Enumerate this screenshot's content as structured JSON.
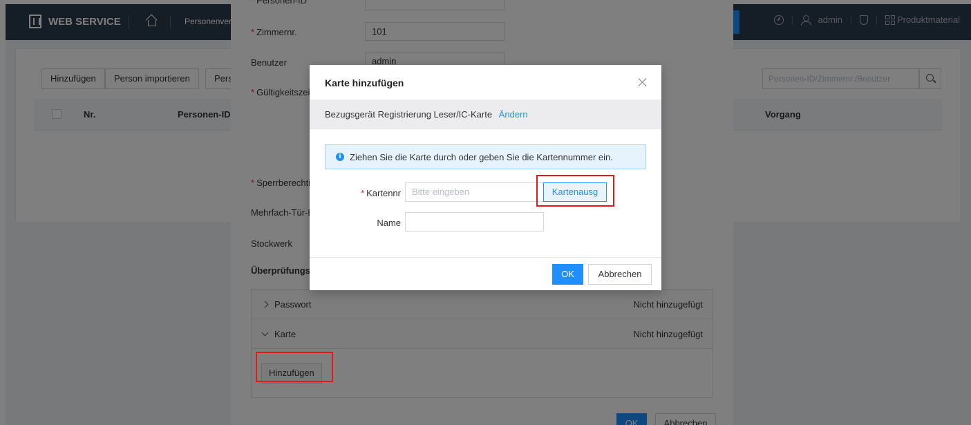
{
  "topbar": {
    "brand": "WEB SERVICE",
    "module": "Personenverwaltung",
    "user": "admin",
    "product": "Produktmaterial",
    "icons": [
      "building-icon",
      "home-icon",
      "gauge-icon",
      "user-icon",
      "shield-icon",
      "grid-icon"
    ]
  },
  "toolbar": {
    "add_label": "Hinzufügen",
    "import_label": "Person importieren",
    "export_label": "Pers",
    "search_placeholder": "Personen-ID/Zimmernr./Benutzer"
  },
  "table": {
    "columns": [
      "Nr.",
      "Personen-ID",
      "Vorgang"
    ]
  },
  "side_panel": {
    "fields": {
      "person_id_label": "Personen-ID",
      "room_label": "Zimmernr.",
      "room_value": "101",
      "user_label": "Benutzer",
      "user_value": "admin",
      "validity_label": "Gültigkeitszeit",
      "lock_label": "Sperrberechtigung",
      "multi_door_label": "Mehrfach-Tür-Entsperrung",
      "floor_label": "Stockwerk",
      "verification_heading": "Überprüfungsmodus"
    },
    "sections": [
      {
        "label": "Passwort",
        "status": "Nicht hinzugefügt",
        "expanded": false
      },
      {
        "label": "Karte",
        "status": "Nicht hinzugefügt",
        "expanded": true
      }
    ],
    "add_button": "Hinzufügen",
    "ok_label": "OK",
    "cancel_label": "Abbrechen"
  },
  "modal": {
    "title": "Karte hinzufügen",
    "device_label": "Bezugsgerät",
    "device_value": "Registrierung Leser/IC-Karte",
    "change_link": "Ändern",
    "info_text": "Ziehen Sie die Karte durch oder geben Sie die Kartennummer ein.",
    "card_no_label": "Kartennr",
    "card_no_placeholder": "Bitte eingeben",
    "read_button": "Kartenausg",
    "name_label": "Name",
    "name_value": "",
    "ok_label": "OK",
    "cancel_label": "Abbrechen"
  },
  "colors": {
    "accent": "#1f8fff",
    "topbar": "#2b3a4e",
    "highlight": "#e4181a",
    "required": "#f5222d"
  }
}
